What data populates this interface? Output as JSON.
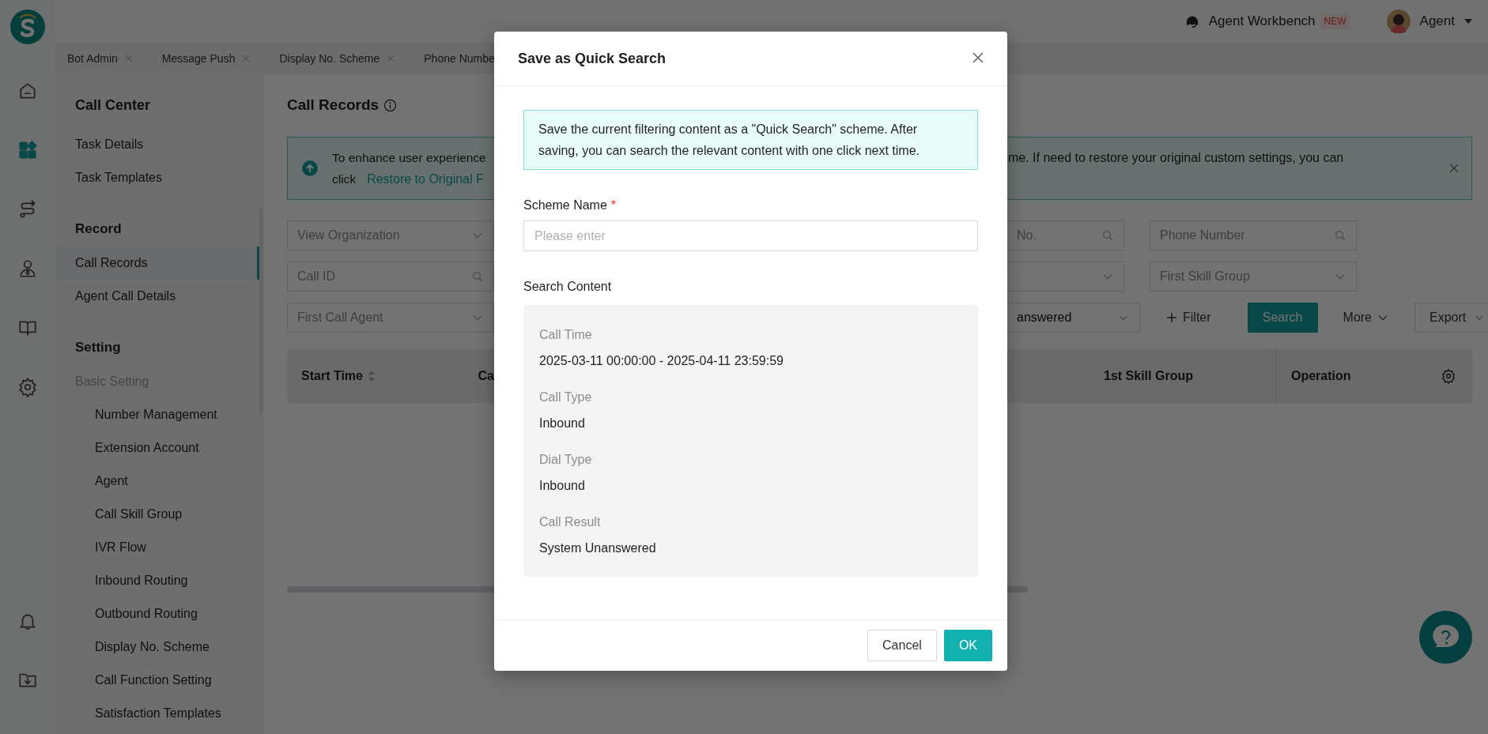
{
  "rail": {
    "top": [
      {
        "kind": "home",
        "selected": false
      },
      {
        "kind": "apps",
        "selected": true
      },
      {
        "kind": "route",
        "selected": false
      },
      {
        "kind": "person",
        "selected": false
      },
      {
        "kind": "book",
        "selected": false
      },
      {
        "kind": "gear",
        "selected": false
      }
    ],
    "bottom": [
      {
        "kind": "bell",
        "selected": false
      },
      {
        "kind": "download",
        "selected": false
      }
    ]
  },
  "topbar": {
    "workbench": "Agent Workbench",
    "badge": "NEW",
    "user": "Agent"
  },
  "tabs": [
    {
      "label": "Bot Admin",
      "closable": true
    },
    {
      "label": "Message Push",
      "closable": true
    },
    {
      "label": "Display No. Scheme",
      "closable": true
    },
    {
      "label": "Phone Numbe",
      "closable": false
    }
  ],
  "sidebar": {
    "title": "Call Center",
    "sections": [
      {
        "items": [
          {
            "label": "Task Details",
            "kind": "link",
            "selected": false
          },
          {
            "label": "Task Templates",
            "kind": "link",
            "selected": false
          }
        ]
      },
      {
        "heading": "Record",
        "items": [
          {
            "label": "Call Records",
            "kind": "link",
            "selected": true
          },
          {
            "label": "Agent Call Details",
            "kind": "link",
            "selected": false
          }
        ]
      },
      {
        "heading": "Setting",
        "items": [
          {
            "label": "Basic Setting",
            "kind": "group",
            "selected": false,
            "children": [
              {
                "label": "Number Management",
                "kind": "link",
                "selected": false
              },
              {
                "label": "Extension Account",
                "kind": "link",
                "selected": false
              },
              {
                "label": "Agent",
                "kind": "link",
                "selected": false
              },
              {
                "label": "Call Skill Group",
                "kind": "link",
                "selected": false
              },
              {
                "label": "IVR Flow",
                "kind": "link",
                "selected": false
              },
              {
                "label": "Inbound Routing",
                "kind": "link",
                "selected": false
              },
              {
                "label": "Outbound Routing",
                "kind": "link",
                "selected": false
              },
              {
                "label": "Display No. Scheme",
                "kind": "link",
                "selected": false
              },
              {
                "label": "Call Function Setting",
                "kind": "link",
                "selected": false
              },
              {
                "label": "Satisfaction Templates",
                "kind": "link",
                "selected": false
              }
            ]
          }
        ]
      }
    ]
  },
  "main": {
    "title": "Call Records",
    "banner": {
      "left_line": "To enhance user experience",
      "left_prefix": "click",
      "link": "Restore to Original F",
      "right_line": "me. If need to restore your original custom settings, you can"
    },
    "filters": [
      {
        "left": {
          "kind": "select",
          "placeholder": "View Organization"
        },
        "right": [
          {
            "kind": "search",
            "placeholder": "No."
          },
          {
            "kind": "search",
            "placeholder": "Phone Number"
          }
        ]
      },
      {
        "left": {
          "kind": "search",
          "placeholder": "Call ID"
        },
        "right": [
          {
            "kind": "select"
          },
          {
            "kind": "select",
            "placeholder": "First Skill Group"
          }
        ]
      },
      {
        "left": {
          "kind": "select",
          "placeholder": "First Call Agent"
        },
        "right": [
          {
            "kind": "select",
            "value": "answered"
          }
        ]
      }
    ],
    "actions": {
      "filter": "Filter",
      "search": "Search",
      "more": "More",
      "export": "Export"
    },
    "table": {
      "left_columns": [
        {
          "label": "Start Time",
          "sortable": true
        },
        {
          "label": "Ca",
          "sortable": false
        }
      ],
      "right_columns": [
        {
          "label": "1st Skill Group"
        },
        {
          "label": "Operation"
        }
      ]
    }
  },
  "modal": {
    "title": "Save as Quick Search",
    "info": "Save the current filtering content as a \"Quick Search\" scheme. After saving, you can search the relevant content with one click next time.",
    "field": {
      "label": "Scheme Name",
      "required_mark": "*",
      "placeholder": "Please enter"
    },
    "section": "Search Content",
    "content": [
      {
        "label": "Call Time",
        "value": "2025-03-11 00:00:00 - 2025-04-11 23:59:59"
      },
      {
        "label": "Call Type",
        "value": "Inbound"
      },
      {
        "label": "Dial Type",
        "value": "Inbound"
      },
      {
        "label": "Call Result",
        "value": "System Unanswered"
      }
    ],
    "buttons": [
      {
        "label": "Cancel",
        "kind": "default"
      },
      {
        "label": "OK",
        "kind": "primary"
      }
    ]
  }
}
